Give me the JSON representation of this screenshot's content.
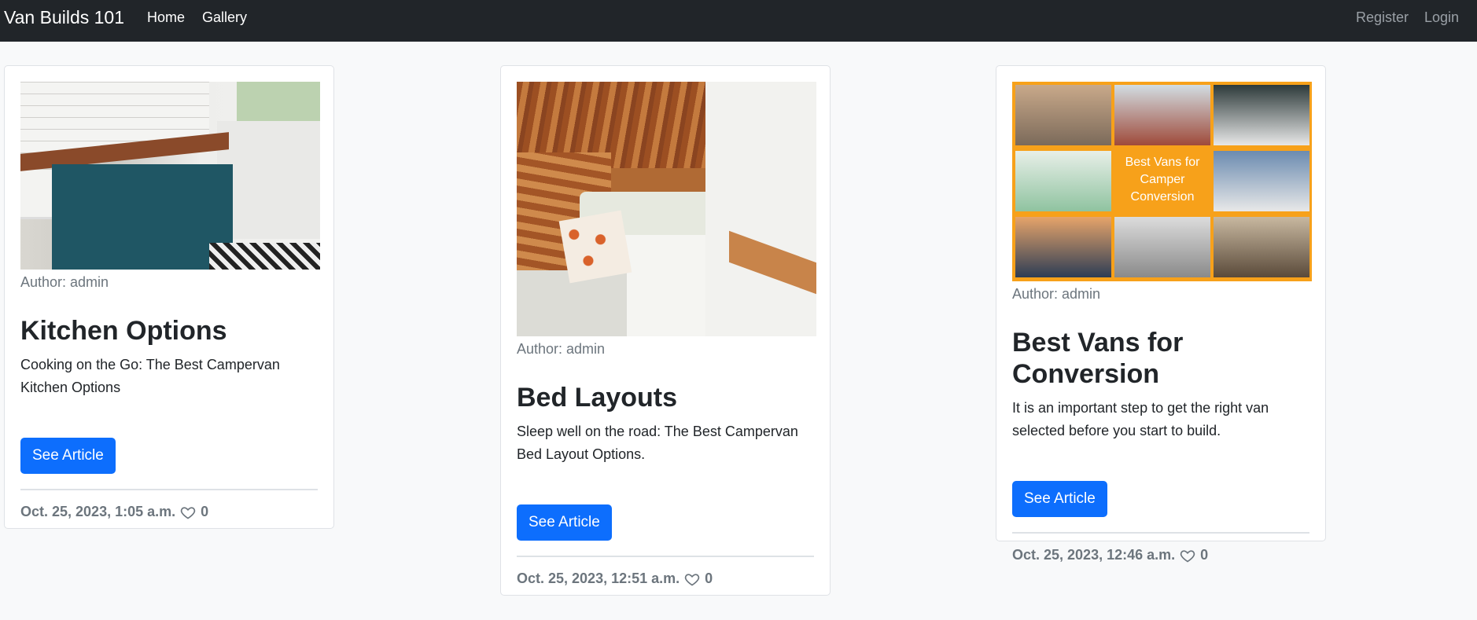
{
  "navbar": {
    "brand": "Van Builds 101",
    "links_left": [
      "Home",
      "Gallery"
    ],
    "links_right": [
      "Register",
      "Login"
    ]
  },
  "cards": [
    {
      "image_alt": "Campervan kitchen with teal cabinets and farmhouse sink",
      "author": "Author: admin",
      "title": "Kitchen Options",
      "description": "Cooking on the Go: The Best Campervan Kitchen Options",
      "button": "See Article",
      "date": "Oct. 25, 2023, 1:05 a.m.",
      "likes": "0"
    },
    {
      "image_alt": "Campervan bed with wood-paneled ceiling",
      "author": "Author: admin",
      "title": "Bed Layouts",
      "description": "Sleep well on the road: The Best Campervan Bed Layout Options.",
      "button": "See Article",
      "date": "Oct. 25, 2023, 12:51 a.m.",
      "likes": "0"
    },
    {
      "image_alt": "Collage of vans",
      "image_text": "Best Vans for Camper Conversion",
      "author": "Author: admin",
      "title": "Best Vans for Conversion",
      "description": "It is an important step to get the right van selected before you start to build.",
      "button": "See Article",
      "date": "Oct. 25, 2023, 12:46 a.m.",
      "likes": "0"
    }
  ],
  "colors": {
    "navbar_bg": "#212529",
    "page_bg": "#f8f9fa",
    "button_bg": "#0d6efd",
    "muted": "#6c757d",
    "collage_orange": "#f7a11a"
  },
  "icons": [
    "heart-icon"
  ]
}
